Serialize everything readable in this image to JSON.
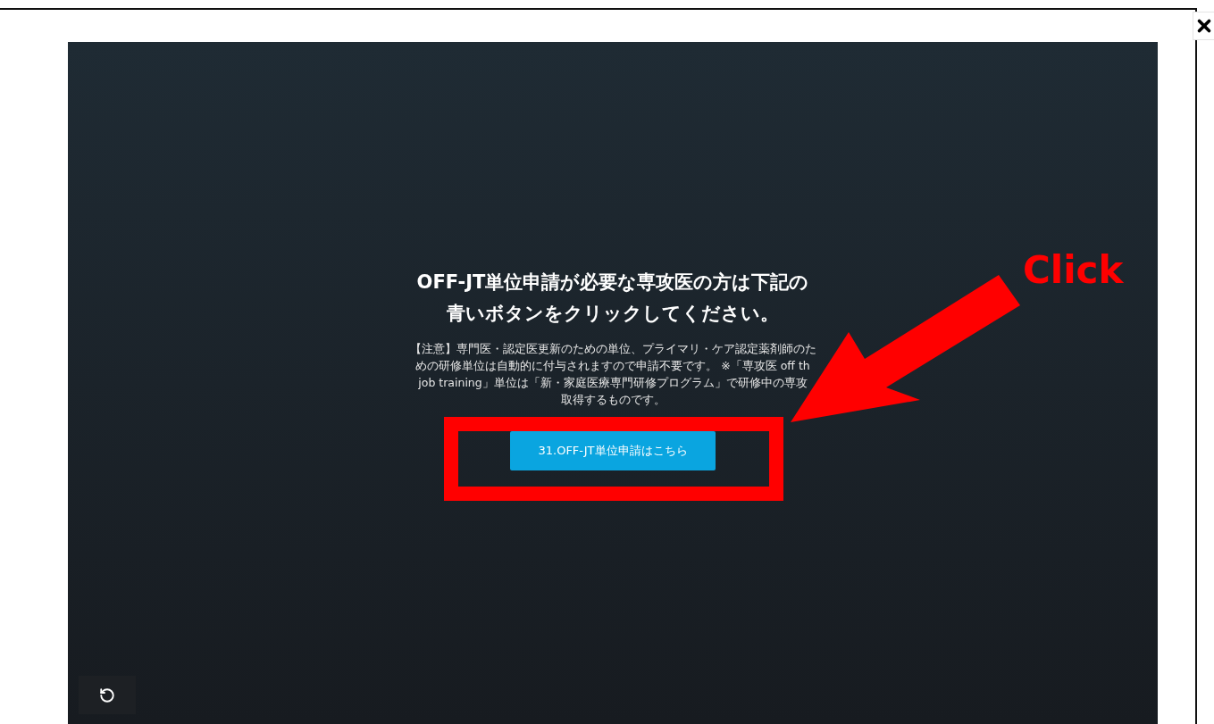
{
  "heading_lines": [
    "OFF-JT単位申請が必要な専攻医の方は下記の",
    "青いボタンをクリックしてください。"
  ],
  "notice_lines": [
    "【注意】専門医・認定医更新のための単位、プライマリ・ケア認定薬剤師のた",
    "めの研修単位は自動的に付与されますので申請不要です。 ※「専攻医 off th",
    "job training」単位は「新・家庭医療専門研修プログラム」で研修中の専攻",
    "取得するものです。"
  ],
  "button": {
    "label": "31.OFF-JT単位申請はこちら"
  },
  "annotation": {
    "label": "Click"
  }
}
